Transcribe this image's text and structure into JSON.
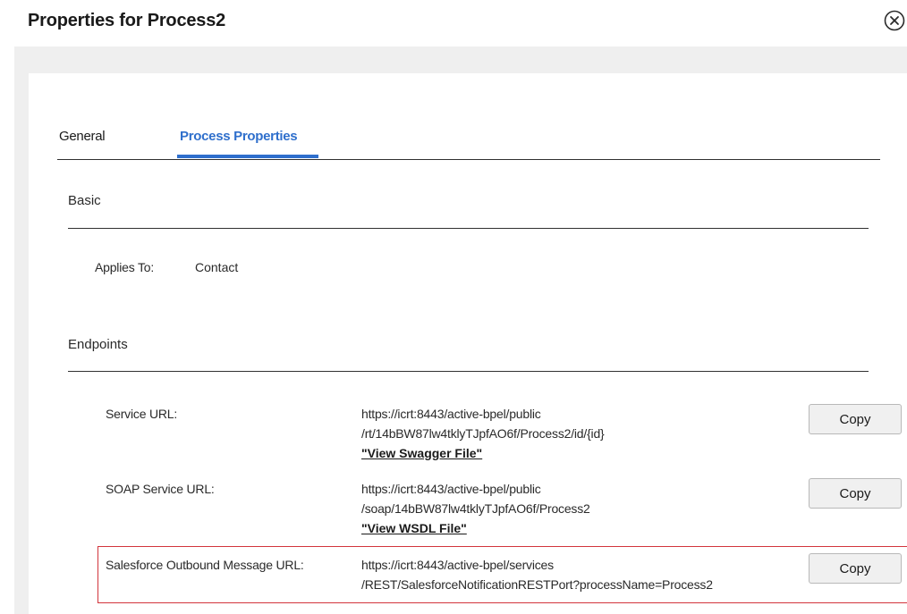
{
  "dialog": {
    "title": "Properties for Process2",
    "close_icon": "close-circle-icon"
  },
  "tabs": [
    {
      "label": "General",
      "active": false
    },
    {
      "label": "Process Properties",
      "active": true
    }
  ],
  "accent_color": "#2f6fcc",
  "highlight_color": "#d2343c",
  "basic": {
    "title": "Basic",
    "applies_to_label": "Applies To:",
    "applies_to_value": "Contact"
  },
  "endpoints": {
    "title": "Endpoints",
    "copy_label": "Copy",
    "items": [
      {
        "label": "Service URL:",
        "url_line1": "https://icrt:8443/active-bpel/public",
        "url_line2": "/rt/14bBW87lw4tklyTJpfAO6f/Process2/id/{id}",
        "link": "\"View Swagger File\""
      },
      {
        "label": "SOAP Service URL:",
        "url_line1": "https://icrt:8443/active-bpel/public",
        "url_line2": "/soap/14bBW87lw4tklyTJpfAO6f/Process2",
        "link": "\"View WSDL File\""
      },
      {
        "label": "Salesforce Outbound Message URL:",
        "url_line1": "https://icrt:8443/active-bpel/services",
        "url_line2": "/REST/SalesforceNotificationRESTPort?processName=Process2",
        "highlighted": true
      }
    ]
  }
}
